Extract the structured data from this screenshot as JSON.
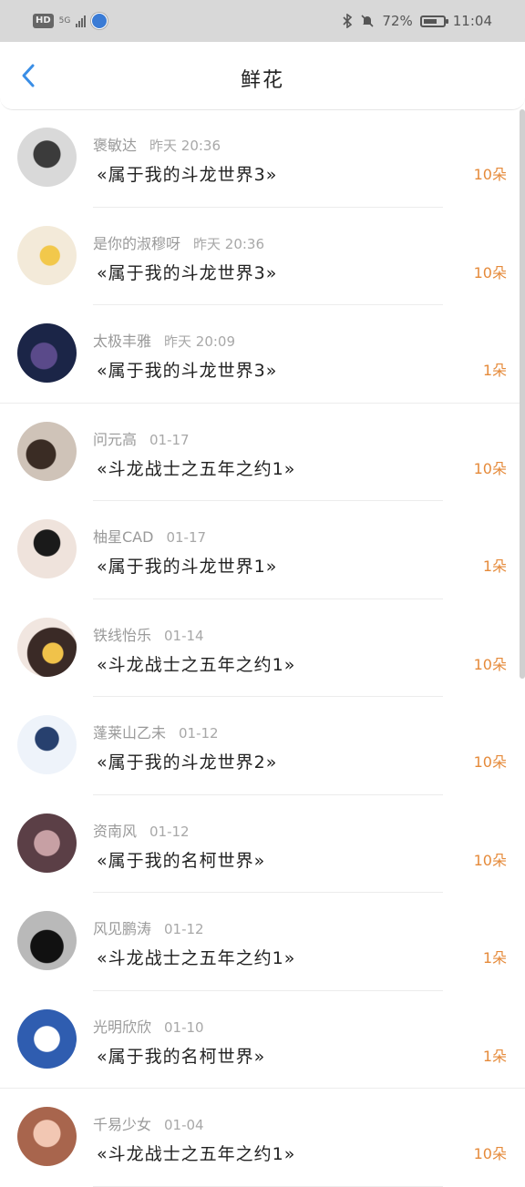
{
  "status_bar": {
    "hd": "HD",
    "network": "5G",
    "battery_text": "72%",
    "battery_level": 0.72,
    "time": "11:04"
  },
  "header": {
    "title": "鲜花"
  },
  "flowers": [
    {
      "name": "褒敏达",
      "time": "昨天 20:36",
      "book": "«属于我的斗龙世界3»",
      "count": "10朵"
    },
    {
      "name": "是你的淑穆呀",
      "time": "昨天 20:36",
      "book": "«属于我的斗龙世界3»",
      "count": "10朵"
    },
    {
      "name": "太极丰雅",
      "time": "昨天 20:09",
      "book": "«属于我的斗龙世界3»",
      "count": "1朵"
    },
    {
      "name": "问元高",
      "time": "01-17",
      "book": "«斗龙战士之五年之约1»",
      "count": "10朵"
    },
    {
      "name": "柚星CAD",
      "time": "01-17",
      "book": "«属于我的斗龙世界1»",
      "count": "1朵"
    },
    {
      "name": "铁线怡乐",
      "time": "01-14",
      "book": "«斗龙战士之五年之约1»",
      "count": "10朵"
    },
    {
      "name": "蓬莱山乙未",
      "time": "01-12",
      "book": "«属于我的斗龙世界2»",
      "count": "10朵"
    },
    {
      "name": "资南风",
      "time": "01-12",
      "book": "«属于我的名柯世界»",
      "count": "10朵"
    },
    {
      "name": "风见鹏涛",
      "time": "01-12",
      "book": "«斗龙战士之五年之约1»",
      "count": "1朵"
    },
    {
      "name": "光明欣欣",
      "time": "01-10",
      "book": "«属于我的名柯世界»",
      "count": "1朵"
    },
    {
      "name": "千易少女",
      "time": "01-04",
      "book": "«斗龙战士之五年之约1»",
      "count": "10朵"
    }
  ],
  "colors": {
    "accent": "#3a8ee6",
    "count": "#e58a3a"
  }
}
